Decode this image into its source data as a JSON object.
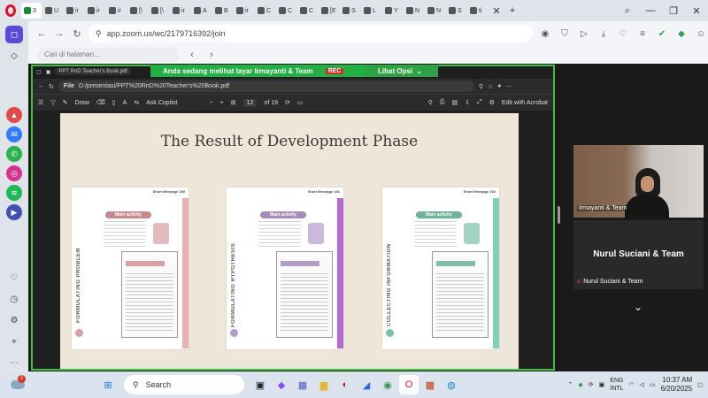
{
  "browser_tabs": [
    {
      "label": "3",
      "color": "#1a8a3a"
    },
    {
      "label": "U",
      "color": "#555"
    },
    {
      "label": "ir",
      "color": "#555"
    },
    {
      "label": "ir",
      "color": "#555"
    },
    {
      "label": "ir",
      "color": "#555"
    },
    {
      "label": "[\\",
      "color": "#555"
    },
    {
      "label": "[\\",
      "color": "#555"
    },
    {
      "label": "ir",
      "color": "#555"
    },
    {
      "label": "A",
      "color": "#555"
    },
    {
      "label": "B",
      "color": "#555"
    },
    {
      "label": "ir",
      "color": "#555"
    },
    {
      "label": "C",
      "color": "#555"
    },
    {
      "label": "C",
      "color": "#555"
    },
    {
      "label": "C",
      "color": "#555"
    },
    {
      "label": "[E",
      "color": "#555"
    },
    {
      "label": "S",
      "color": "#555"
    },
    {
      "label": "L",
      "color": "#555"
    },
    {
      "label": "Y",
      "color": "#555"
    },
    {
      "label": "N",
      "color": "#555"
    },
    {
      "label": "N",
      "color": "#555"
    },
    {
      "label": "S",
      "color": "#555"
    },
    {
      "label": "ti",
      "color": "#555"
    }
  ],
  "address": {
    "url": "app.zoom.us/wc/2179716392/join"
  },
  "find": {
    "placeholder": "Cari di halaman..."
  },
  "zoom": {
    "share_banner": "Anda sedang melihat layar Irmayanti & Team",
    "rec": "REC",
    "view_options": "Lihat Opsi"
  },
  "pdf": {
    "tab_title": "PPT RnD Teacher's Book.pdf",
    "file_badge": "File",
    "path": "D:/presentasi/PPT%20RnD%20Teacher's%20Book.pdf",
    "draw": "Draw",
    "ask_copilot": "Ask Copilot",
    "page_number": "12",
    "page_total": "of 19",
    "edit_acrobat": "Edit with Acrobat"
  },
  "slide": {
    "title": "The Result of Development Phase",
    "cards": [
      {
        "section": "FORMULATING PROBLEM",
        "pill": "Main activity",
        "header": "Short Message",
        "num": "190",
        "accent": "#d9a0a4",
        "pill_color": "#c78a8e",
        "stripe": "#e9b1b3"
      },
      {
        "section": "FORMULATING HYPOTHESIS",
        "pill": "Main activity",
        "header": "Short Message",
        "num": "191",
        "accent": "#b39dc6",
        "pill_color": "#a78ab5",
        "stripe": "#b56ad8"
      },
      {
        "section": "COLLECTING INFORMATION",
        "pill": "Main activity",
        "header": "Short Message",
        "num": "192",
        "accent": "#7fc0a8",
        "pill_color": "#6db398",
        "stripe": "#7fd1b6"
      }
    ]
  },
  "participants": {
    "video_name": "Irmayanti & Team",
    "tile_name": "Nurul Suciani & Team",
    "tile_small": "Nurul Suciani & Team"
  },
  "taskbar": {
    "search": "Search",
    "weather_badge": "2",
    "lang_top": "ENG",
    "lang_bottom": "INTL",
    "time": "10:37 AM",
    "date": "6/20/2025"
  }
}
